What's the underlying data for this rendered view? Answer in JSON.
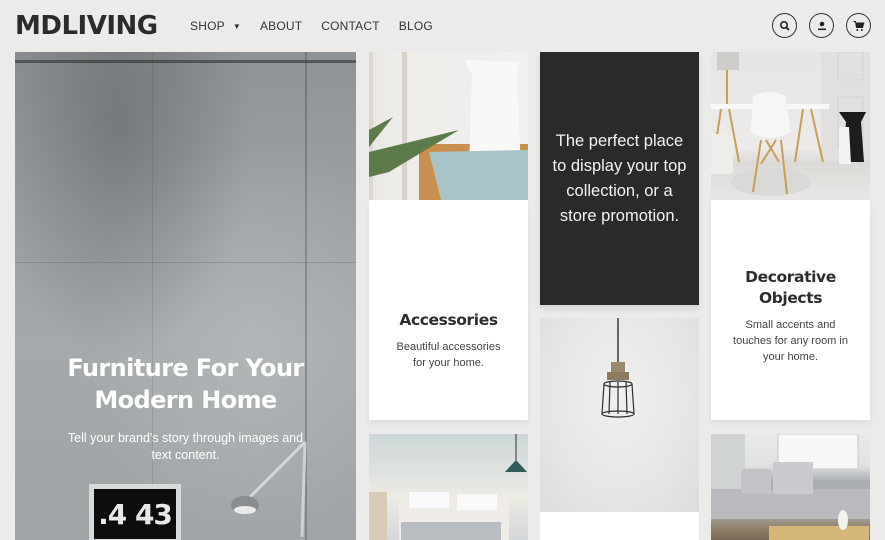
{
  "header": {
    "logo": "MDLIVING",
    "nav": [
      {
        "label": "SHOP",
        "has_dropdown": true
      },
      {
        "label": "ABOUT"
      },
      {
        "label": "CONTACT"
      },
      {
        "label": "BLOG"
      }
    ],
    "icons": [
      "search-icon",
      "account-icon",
      "cart-icon"
    ]
  },
  "hero": {
    "title": "Furniture For Your Modern Home",
    "subtitle": "Tell your brand's story through images and text content.",
    "clock_display": ".4 43"
  },
  "tiles": {
    "accessories": {
      "title": "Accessories",
      "description": "Beautiful accessories for your home."
    },
    "promo": {
      "text": "The perfect place to display your top collection, or a store promotion."
    },
    "decorative": {
      "title": "Decorative Objects",
      "description": "Small accents and touches for any room in your home."
    }
  },
  "colors": {
    "background": "#ebebe9",
    "promo_bg": "#2a2a2a",
    "text_dark": "#2d2d2d"
  }
}
